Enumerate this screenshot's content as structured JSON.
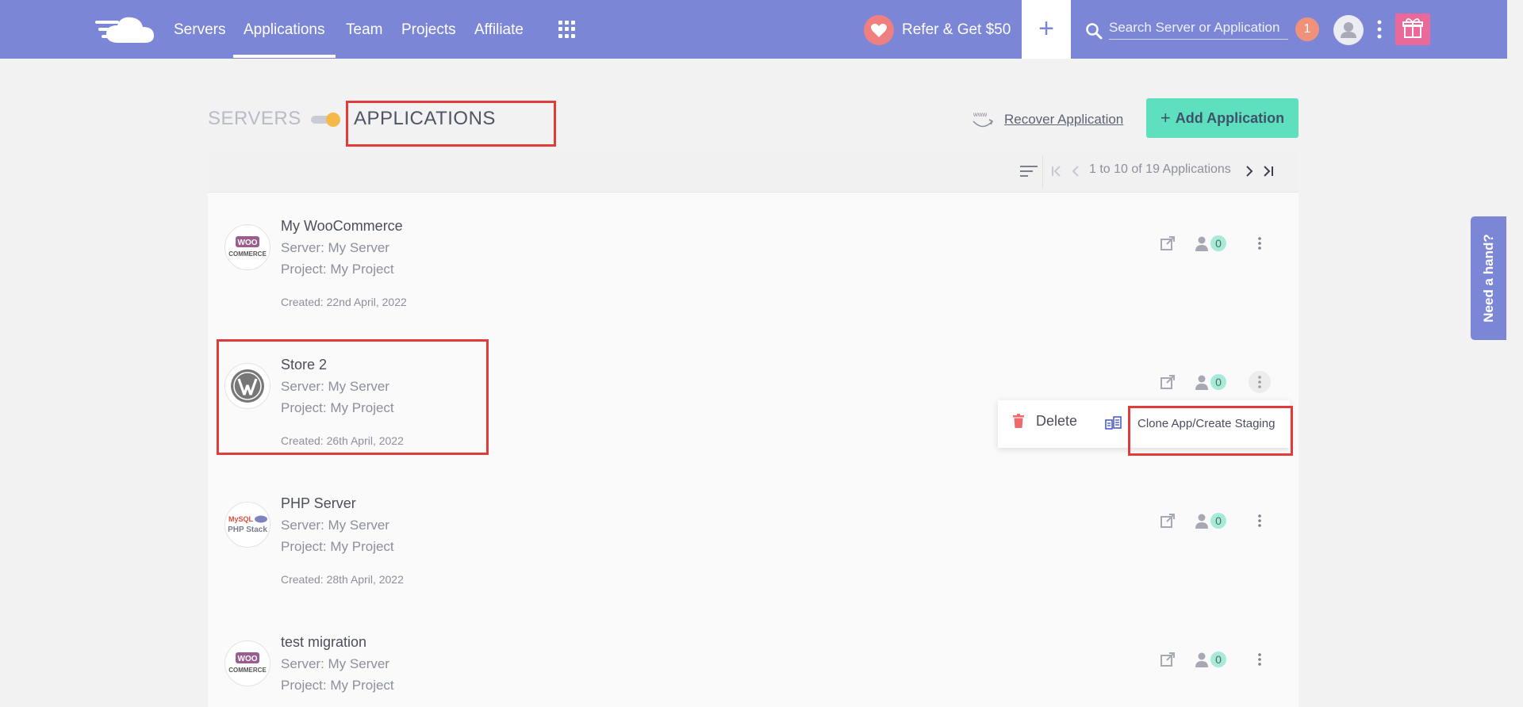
{
  "nav": {
    "items": [
      "Servers",
      "Applications",
      "Team",
      "Projects",
      "Affiliate"
    ],
    "active": "Applications",
    "refer_label": "Refer & Get $50",
    "plus_label": "+",
    "search_placeholder": "Search Server or Application",
    "notification_count": "1"
  },
  "header": {
    "servers_tab": "SERVERS",
    "applications_tab": "APPLICATIONS",
    "recover_label": "Recover Application",
    "add_app_label": "Add Application",
    "add_app_plus": "+"
  },
  "pager": {
    "text": "1 to 10 of 19 Applications"
  },
  "apps": [
    {
      "name": "My WooCommerce",
      "server": "Server: My Server",
      "project": "Project: My Project",
      "created": "Created: 22nd April, 2022",
      "logo": "woocommerce-logo",
      "members": "0"
    },
    {
      "name": "Store 2",
      "server": "Server: My Server",
      "project": "Project: My Project",
      "created": "Created: 26th April, 2022",
      "logo": "wordpress-logo",
      "members": "0"
    },
    {
      "name": "PHP Server",
      "server": "Server: My Server",
      "project": "Project: My Project",
      "created": "Created: 28th April, 2022",
      "logo": "php-stack-logo",
      "members": "0"
    },
    {
      "name": "test migration",
      "server": "Server: My Server",
      "project": "Project: My Project",
      "created": "",
      "logo": "woocommerce-logo",
      "members": "0"
    }
  ],
  "logo_text": {
    "woo_top": "WOO",
    "woo_bottom": "COMMERCE",
    "php_top": "MySQL",
    "php_bottom": "PHP Stack"
  },
  "dropdown": {
    "delete_label": "Delete",
    "clone_label": "Clone App/Create Staging"
  },
  "help_tab": "Need a hand?",
  "colors": {
    "nav_bg": "#7c86d6",
    "accent_green": "#5ee0bf",
    "highlight_red": "#e03c3c",
    "gift_pink": "#e8699a"
  }
}
